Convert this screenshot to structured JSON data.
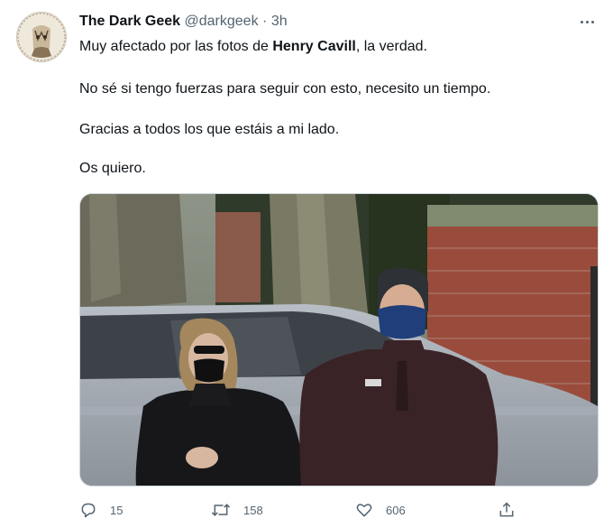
{
  "tweet": {
    "author": {
      "name": "The Dark Geek",
      "handle": "@darkgeek",
      "separator": "·",
      "time": "3h"
    },
    "text": {
      "line1_before": "Muy afectado por las fotos de ",
      "line1_bold": "Henry Cavill",
      "line1_after": ", la verdad.",
      "line2": "No sé si tengo fuerzas para seguir con esto, necesito un tiempo.",
      "line3": "Gracias a todos los que estáis a mi lado.",
      "line4": "Os quiero."
    },
    "actions": {
      "replies": "15",
      "retweets": "158",
      "likes": "606"
    }
  },
  "icons": {
    "more": "more-horizontal-icon",
    "reply": "reply-bubble-icon",
    "retweet": "retweet-arrows-icon",
    "like": "heart-icon",
    "share": "share-upload-icon"
  },
  "colors": {
    "text_primary": "#0f1419",
    "text_secondary": "#536471",
    "border": "#cfd9de"
  }
}
